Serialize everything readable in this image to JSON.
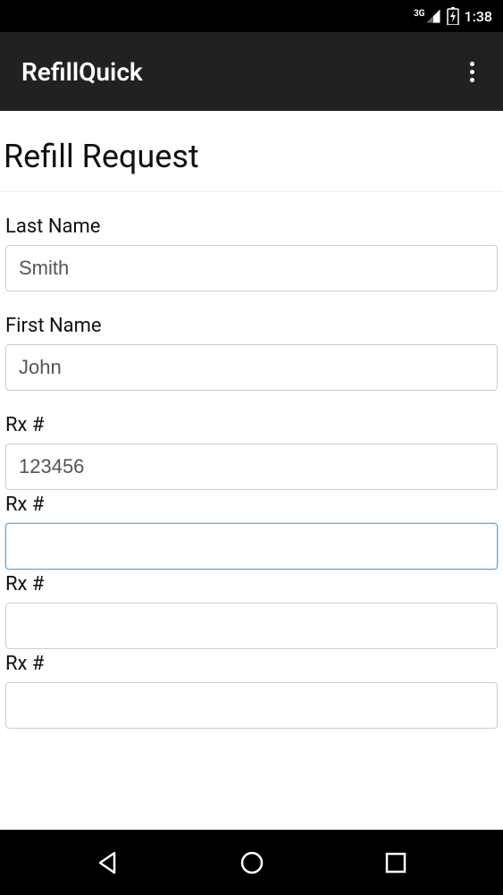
{
  "status": {
    "signal_label": "3G",
    "time": "1:38"
  },
  "appbar": {
    "title": "RefillQuick"
  },
  "page": {
    "title": "Refill Request"
  },
  "fields": {
    "last_name": {
      "label": "Last Name",
      "value": "Smith"
    },
    "first_name": {
      "label": "First Name",
      "value": "John"
    },
    "rx1": {
      "label": "Rx #",
      "value": "123456"
    },
    "rx2": {
      "label": "Rx #",
      "value": ""
    },
    "rx3": {
      "label": "Rx #",
      "value": ""
    },
    "rx4": {
      "label": "Rx #",
      "value": ""
    }
  }
}
